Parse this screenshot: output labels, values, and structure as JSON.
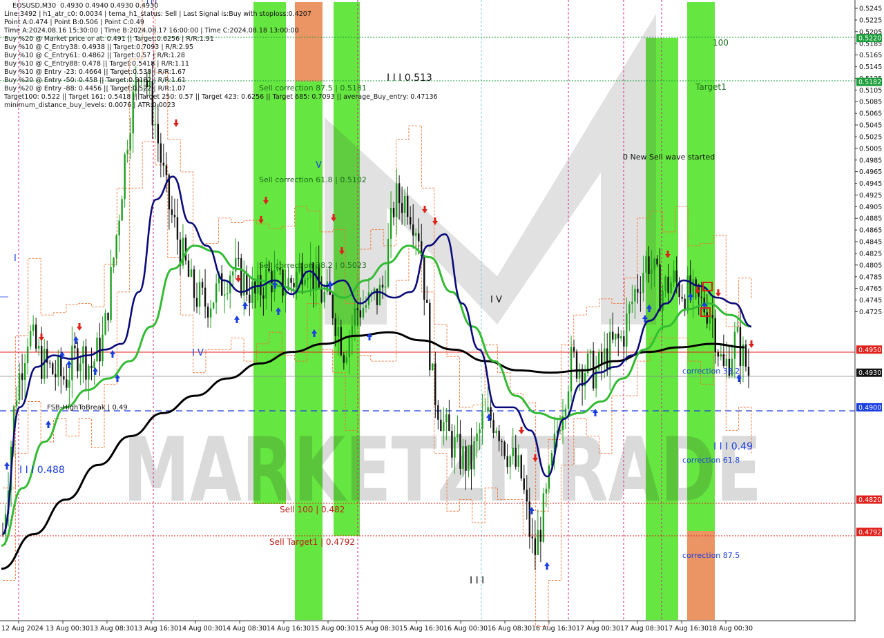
{
  "header": {
    "title": "EOSUSD,M30  0.4930 0.4940 0.4930 0.4930",
    "lines": [
      "Line:3492 | h1_atr_c0: 0.0034 | tema_h1_status: Sell | Last Signal is:Buy with stoploss:0.4207",
      "Point A:0.474 | Point B:0.506 | Point C:0.49",
      "Time A:2024.08.16 15:30:00 | Time B:2024.08.17 16:00:00 | Time C:2024.08.18 13:00:00",
      "Buy %20 @ Market price or at: 0.491 || Target:0.6256 | R/R:1.91",
      "Buy %10 @ C_Entry38: 0.4938 || Target:0.7093 | R/R:2.95",
      "Buy %10 @ C_Entry61: 0.4862 || Target:0.57 | R/R:1.28",
      "Buy %10 @ C_Entry88: 0.478 || Target:0.5418 | R/R:1.11",
      "Buy %10 @ Entry -23: 0.4664 || Target:0.538 | R/R:1.67",
      "Buy %20 @ Entry -50: 0.458 || Target:0.5182 | R/R:1.61",
      "Buy %20 @ Entry -88: 0.4456 || Target:0.522 | R/R:1.07",
      "Target100: 0.522 || Target 161: 0.5418 || Target 250: 0.57 || Target 423: 0.6256 || Target 685: 0.7093 || average_Buy_entry: 0.47136",
      "minimum_distance_buy_levels: 0.0076 | ATR:0.0023"
    ]
  },
  "watermark": "MARKETZITRADE",
  "price_axis": {
    "ticks": [
      "0.5245",
      "0.5205",
      "0.5165",
      "0.5125",
      "0.5085",
      "0.5045",
      "0.5005",
      "0.4965",
      "0.4925",
      "0.4885",
      "0.4845",
      "0.4805",
      "0.4765",
      "0.4725"
    ],
    "ticks_b": [
      "0.5225",
      "0.5185",
      "0.5145",
      "0.5105",
      "0.5065",
      "0.5025",
      "0.4985",
      "0.4945",
      "0.4905",
      "0.4865",
      "0.4825",
      "0.4785",
      "0.4745"
    ],
    "tags": [
      {
        "label": "0.5220",
        "bg": "#1a9e3a"
      },
      {
        "label": "0.5182",
        "bg": "#1a9e3a"
      },
      {
        "label": "0.4950",
        "bg": "#e0201a"
      },
      {
        "label": "0.4930",
        "bg": "#111111"
      },
      {
        "label": "0.4900",
        "bg": "#1a3ee0"
      },
      {
        "label": "0.4820",
        "bg": "#e0201a"
      },
      {
        "label": "0.4792",
        "bg": "#e0201a"
      }
    ]
  },
  "time_axis": [
    "12 Aug 2024",
    "13 Aug 00:30",
    "13 Aug 08:30",
    "13 Aug 16:30",
    "14 Aug 00:30",
    "14 Aug 08:30",
    "14 Aug 16:30",
    "15 Aug 00:30",
    "15 Aug 08:30",
    "15 Aug 16:30",
    "16 Aug 00:30",
    "16 Aug 08:30",
    "16 Aug 16:30",
    "17 Aug 00:30",
    "17 Aug 08:30",
    "17 Aug 16:30",
    "18 Aug 00:30"
  ],
  "labels": {
    "sell_correction_875": "Sell correction 87.5 | 0.5181",
    "sell_correction_618": "Sell correction 61.8 | 0.5102",
    "sell_correction_382": "Sell correction 38.2 | 0.5023",
    "sell_100": "Sell 100 | 0.482",
    "sell_target1": "Sell Target1 | 0.4792",
    "wave_0513": "I I I 0.513",
    "wave_0488": "I I I 0.488",
    "wave_049": "I I I 0.49",
    "wave_iv_a": "I V",
    "wave_iv_b": "I V",
    "wave_v": "V",
    "wave_i": "I",
    "wave_iii": "I I I",
    "fsb": "FSB-HighToBreak | 0.49",
    "new_sell_wave": "0 New Sell wave started",
    "level_100": "100",
    "target1": "Target1",
    "correction_382": "correction 38.2",
    "correction_618": "correction 61.8",
    "correction_875": "correction 87.5"
  },
  "colors": {
    "green_band": "#33dd00",
    "orange_band": "#e8824a",
    "dark_blue_line": "#0a0a7a",
    "green_ma": "#33bb33",
    "black_ma": "#000000",
    "red_level": "#e0201a",
    "blue_level": "#1a3ee0",
    "green_level": "#1a9e3a",
    "buy_arrow": "#1a3ee0",
    "sell_arrow": "#e0201a"
  },
  "chart_data": {
    "type": "candlestick",
    "symbol": "EOSUSD",
    "timeframe": "M30",
    "ylim": [
      0.4715,
      0.5253
    ],
    "x_labels": [
      "12 Aug 2024",
      "13 Aug 00:30",
      "13 Aug 08:30",
      "13 Aug 16:30",
      "14 Aug 00:30",
      "14 Aug 08:30",
      "14 Aug 16:30",
      "15 Aug 00:30",
      "15 Aug 08:30",
      "15 Aug 16:30",
      "16 Aug 00:30",
      "16 Aug 08:30",
      "16 Aug 16:30",
      "17 Aug 00:30",
      "17 Aug 08:30",
      "17 Aug 16:30",
      "18 Aug 00:30"
    ],
    "horizontal_levels": [
      {
        "value": 0.522,
        "color": "#1a9e3a",
        "style": "dotted"
      },
      {
        "value": 0.5182,
        "color": "#1a9e3a",
        "style": "dotted"
      },
      {
        "value": 0.495,
        "color": "#e0201a",
        "style": "solid"
      },
      {
        "value": 0.493,
        "color": "#111111",
        "style": "solid"
      },
      {
        "value": 0.49,
        "color": "#1a3ee0",
        "style": "dashed"
      },
      {
        "value": 0.482,
        "color": "#e0201a",
        "style": "dotted"
      },
      {
        "value": 0.4792,
        "color": "#e0201a",
        "style": "dotted"
      }
    ],
    "close_path": [
      0.479,
      0.491,
      0.4965,
      0.494,
      0.493,
      0.4925,
      0.495,
      0.4935,
      0.496,
      0.505,
      0.515,
      0.52,
      0.515,
      0.508,
      0.504,
      0.5,
      0.499,
      0.5,
      0.502,
      0.501,
      0.4995,
      0.5015,
      0.5005,
      0.501,
      0.503,
      0.5,
      0.499,
      0.495,
      0.4985,
      0.499,
      0.5,
      0.508,
      0.508,
      0.505,
      0.492,
      0.488,
      0.486,
      0.485,
      0.489,
      0.489,
      0.486,
      0.484,
      0.477,
      0.482,
      0.489,
      0.494,
      0.4935,
      0.493,
      0.495,
      0.496,
      0.5,
      0.503,
      0.5,
      0.501,
      0.5,
      0.499,
      0.4985,
      0.493,
      0.496,
      0.493
    ],
    "dark_blue_ma": [
      0.479,
      0.49,
      0.4935,
      0.4945,
      0.4942,
      0.4945,
      0.495,
      0.4955,
      0.5,
      0.508,
      0.51,
      0.506,
      0.504,
      0.501,
      0.5,
      0.5005,
      0.501,
      0.4998,
      0.5018,
      0.5005,
      0.501,
      0.499,
      0.5,
      0.4995,
      0.5,
      0.504,
      0.505,
      0.499,
      0.495,
      0.49,
      0.49,
      0.488,
      0.484,
      0.489,
      0.492,
      0.493,
      0.4935,
      0.4945,
      0.4975,
      0.499,
      0.501,
      0.5005,
      0.4995,
      0.499,
      0.497
    ],
    "green_ma": [
      0.478,
      0.483,
      0.487,
      0.49,
      0.4915,
      0.4925,
      0.494,
      0.497,
      0.502,
      0.504,
      0.5035,
      0.502,
      0.501,
      0.5005,
      0.5,
      0.5003,
      0.4995,
      0.501,
      0.5025,
      0.504,
      0.503,
      0.5,
      0.497,
      0.494,
      0.491,
      0.4895,
      0.489,
      0.4895,
      0.4905,
      0.4925,
      0.495,
      0.497,
      0.4985,
      0.499,
      0.498,
      0.497
    ],
    "black_ma": [
      0.476,
      0.479,
      0.482,
      0.485,
      0.4875,
      0.4895,
      0.491,
      0.4925,
      0.4938,
      0.4948,
      0.4955,
      0.4962,
      0.4965,
      0.4958,
      0.495,
      0.494,
      0.4932,
      0.493,
      0.4932,
      0.494,
      0.4948,
      0.4952,
      0.4955,
      0.4952
    ]
  }
}
